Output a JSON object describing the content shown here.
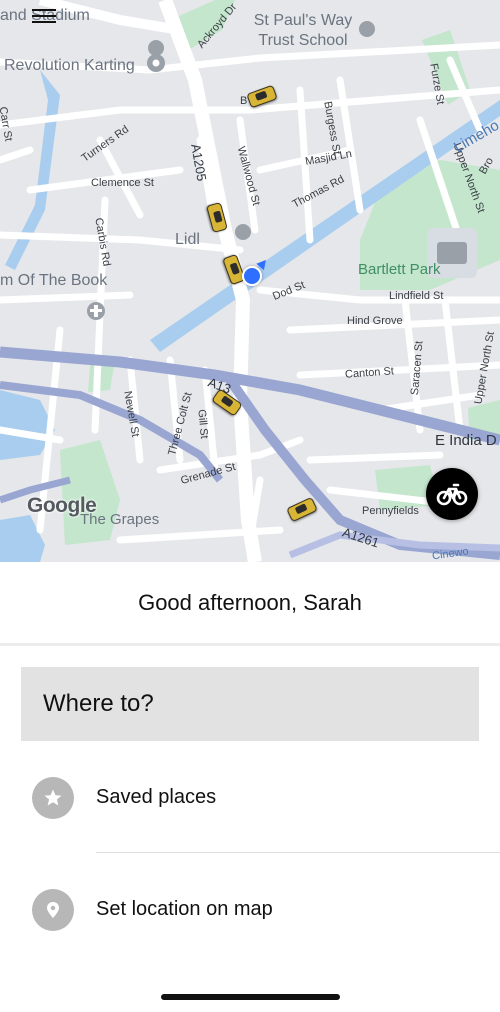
{
  "map": {
    "labels": {
      "stadium_fragment": "and Stadium",
      "revolution_karting": "Revolution Karting",
      "st_pauls_way_school": "St Paul's Way Trust School",
      "book_fragment": "m Of The Book",
      "lidl": "Lidl",
      "bartlett_park": "Bartlett Park",
      "the_grapes": "The Grapes",
      "ackroyd_dr": "Ackroyd Dr",
      "turners_rd": "Turners Rd",
      "clemence_st": "Clemence St",
      "a1205": "A1205",
      "wallwood_st": "Wallwood St",
      "masjid_ln": "Masjid Ln",
      "burgess_st": "Burgess St",
      "thomas_rd": "Thomas Rd",
      "carbis_rd": "Carbis Rd",
      "dod_st": "Dod St",
      "lindfield_st": "Lindfield St",
      "hind_grove": "Hind Grove",
      "canton_st": "Canton St",
      "saracen_st": "Saracen St",
      "upper_north_st_bottom": "Upper North St",
      "upper_north_st_top": "Upper North St",
      "furze_st": "Furze St",
      "limehouse_fragment": "Limeho",
      "a13": "A13",
      "e_india_d": "E India D",
      "newell_st": "Newell St",
      "three_colt_st": "Three Colt St",
      "gill_st": "Gill St",
      "grenade_st": "Grenade St",
      "pennyfields": "Pennyfields",
      "a1261": "A1261",
      "carr_st": "Carr St",
      "b_fragment": "B",
      "broo_fragment": "Bro",
      "cinewo_fragment": "Cinewo"
    },
    "google_logo": "Google",
    "menu_icon": "hamburger-menu-icon",
    "bike_icon": "bicycle-icon",
    "colors": {
      "road": "#ffffff",
      "land": "#e5e7ea",
      "park": "#c4e6cc",
      "water": "#a9cdee",
      "major_road": "#9aa6d2",
      "user_location": "#2f6fff",
      "car": "#d9b535"
    }
  },
  "sheet": {
    "greeting": "Good afternoon, Sarah",
    "search": {
      "label": "Where to?"
    },
    "rows": [
      {
        "label": "Saved places",
        "icon": "star-icon"
      },
      {
        "label": "Set location on map",
        "icon": "map-pin-icon"
      }
    ]
  }
}
